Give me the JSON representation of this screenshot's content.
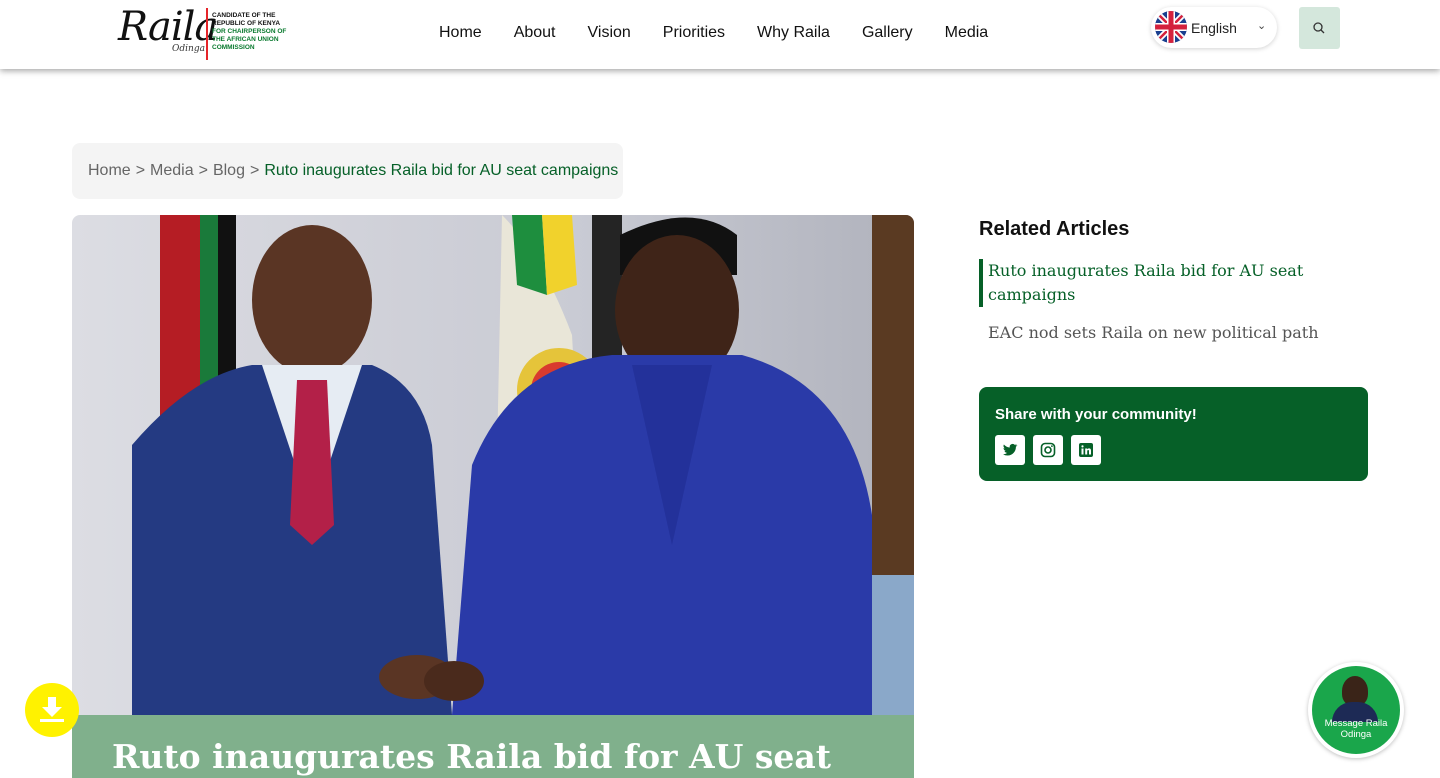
{
  "header": {
    "logo": {
      "script_text": "Raila",
      "sub_script": "Odinga",
      "candidate_line": "CANDIDATE OF THE REPUBLIC OF KENYA",
      "position_line": "FOR CHAIRPERSON OF THE AFRICAN UNION COMMISSION"
    },
    "nav": [
      {
        "label": "Home"
      },
      {
        "label": "About"
      },
      {
        "label": "Vision"
      },
      {
        "label": "Priorities"
      },
      {
        "label": "Why Raila"
      },
      {
        "label": "Gallery"
      },
      {
        "label": "Media"
      }
    ],
    "language": {
      "label": "English",
      "flag_icon": "uk-flag-icon"
    },
    "search_icon": "search-icon"
  },
  "breadcrumb": {
    "items": [
      "Home",
      "Media",
      "Blog"
    ],
    "separator": ">",
    "current": "Ruto inaugurates Raila bid for AU seat campaigns"
  },
  "article": {
    "title": "Ruto inaugurates Raila bid for AU seat"
  },
  "sidebar": {
    "related_heading": "Related Articles",
    "related": [
      {
        "label": "Ruto inaugurates Raila bid for AU seat campaigns",
        "active": true
      },
      {
        "label": "EAC nod sets Raila on new political path",
        "active": false
      }
    ],
    "share": {
      "title": "Share with your community!",
      "icons": [
        "twitter-icon",
        "instagram-icon",
        "linkedin-icon"
      ]
    }
  },
  "floating": {
    "download_icon": "download-icon",
    "message_label": "Message Raila Odinga"
  },
  "colors": {
    "brand_green": "#066028",
    "caption_green": "#80b08c",
    "download_yellow": "#fff200",
    "search_bg": "#d4e7dc"
  }
}
